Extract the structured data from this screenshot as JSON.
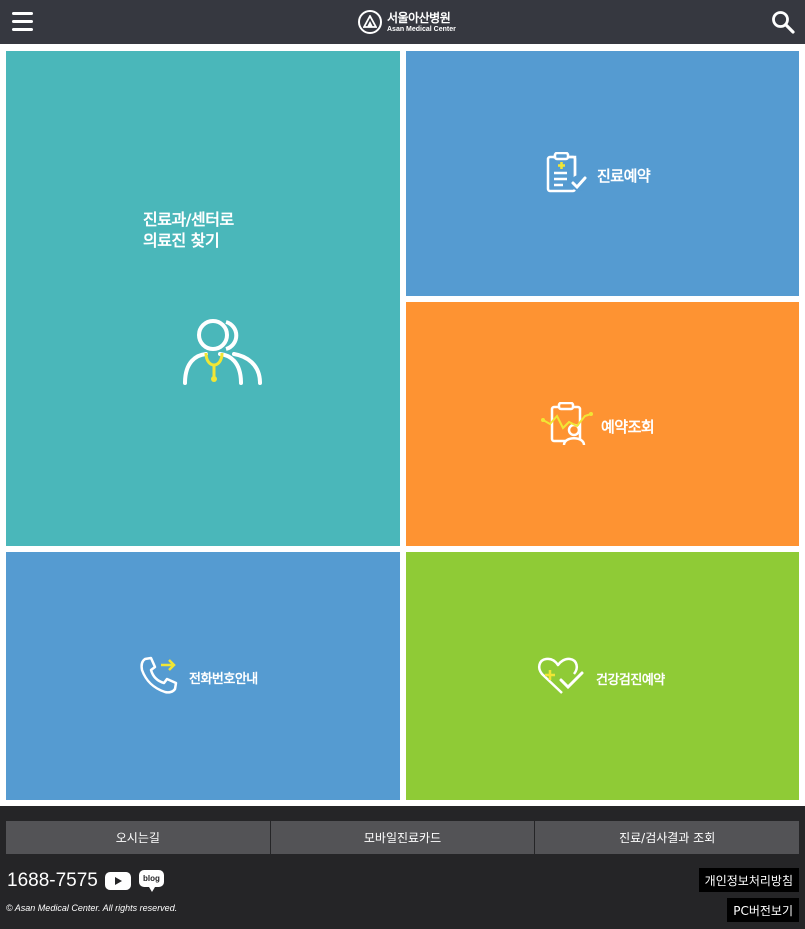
{
  "header": {
    "logo_ko": "서울아산병원",
    "logo_en": "Asan Medical Center",
    "menu_icon": "hamburger-icon",
    "search_icon": "search-icon"
  },
  "tiles": {
    "find": {
      "label": "진료과/센터로\n의료진 찾기",
      "color": "#4ab7ba",
      "icon": "doctors-stethoscope-icon"
    },
    "reserve": {
      "label": "진료예약",
      "color": "#559bd1",
      "icon": "clipboard-check-icon"
    },
    "check": {
      "label": "예약조회",
      "color": "#fe9332",
      "icon": "clipboard-person-icon"
    },
    "phone": {
      "label": "전화번호안내",
      "color": "#559bd1",
      "icon": "phone-arrow-icon"
    },
    "health": {
      "label": "건강검진예약",
      "color": "#8fcb36",
      "icon": "heart-check-icon"
    }
  },
  "footer": {
    "links": [
      "오시는길",
      "모바일진료카드",
      "진료/검사결과 조회"
    ],
    "phone": "1688-7575",
    "blog_label": "blog",
    "copyright": "© Asan Medical Center. All rights reserved.",
    "privacy": "개인정보처리방침",
    "pc_view": "PC버전보기"
  },
  "colors": {
    "header_bg": "#363840",
    "footer_bg": "#252527",
    "accent_yellow": "#f1e634"
  }
}
